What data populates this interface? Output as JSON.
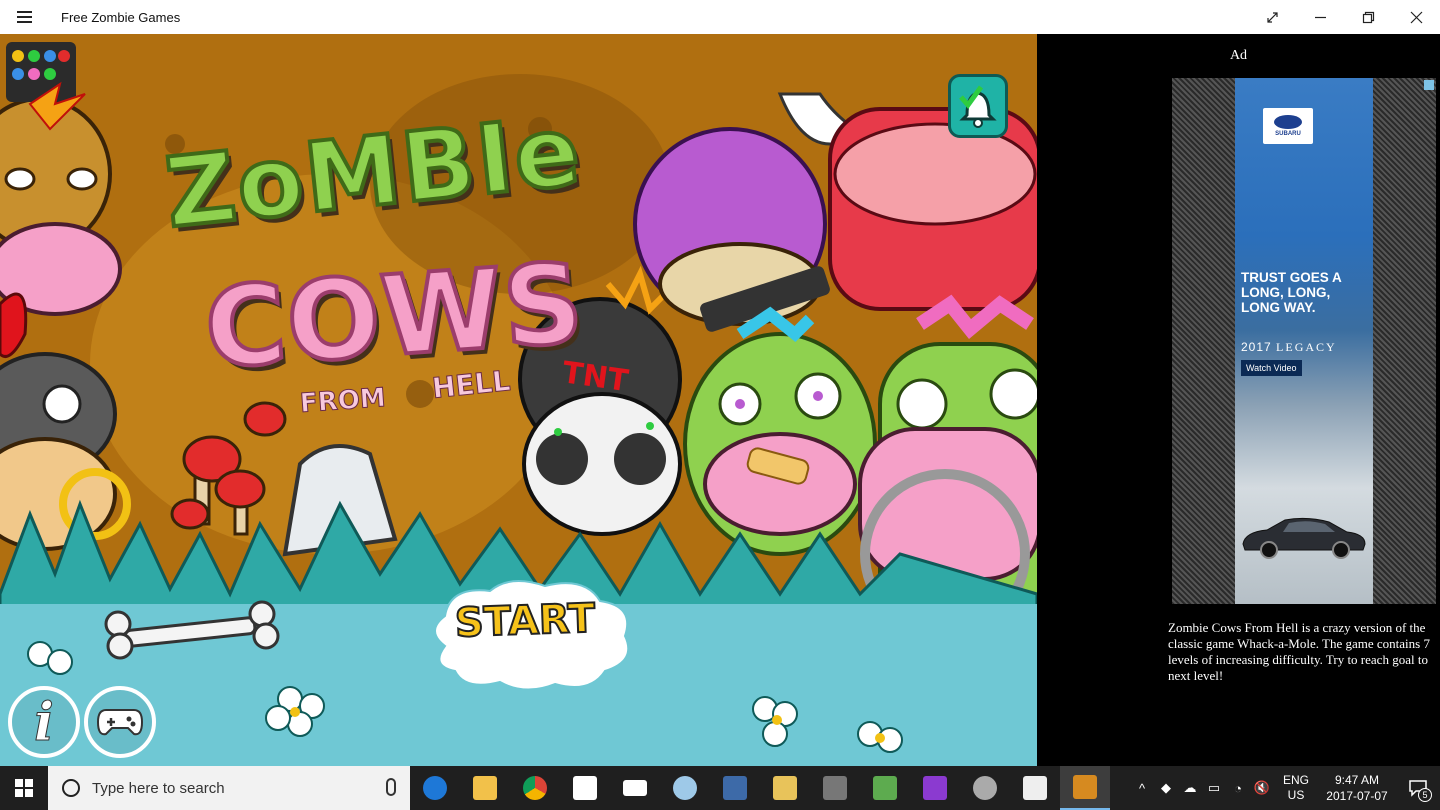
{
  "window": {
    "title": "Free Zombie Games",
    "menu_icon": "hamburger-icon",
    "controls": [
      "fullscreen-icon",
      "minimize-icon",
      "restore-icon",
      "close-icon"
    ]
  },
  "game": {
    "title_line1": "ZoMBIe",
    "title_line2": "COWS",
    "title_from": "FROM",
    "title_hell": "HELL",
    "tnt_label": "TNT",
    "start_label": "START",
    "info_label": "i",
    "icons": [
      "logo-icon",
      "bell-icon",
      "info-icon",
      "gamepad-icon"
    ]
  },
  "ad": {
    "label": "Ad",
    "brand": "SUBARU",
    "headline": "TRUST GOES A LONG, LONG, LONG WAY.",
    "model_year": "2017",
    "model_name": "LEGACY",
    "cta": "Watch Video",
    "description": "Zombie Cows From Hell is a crazy version of the classic game Whack-a-Mole. The game contains 7 levels of increasing difficulty. Try to reach goal to next level!"
  },
  "taskbar": {
    "search_placeholder": "Type here to search",
    "apps": [
      "edge-icon",
      "file-explorer-icon",
      "chrome-icon",
      "store-icon",
      "mail-icon",
      "paint-icon",
      "photos-icon",
      "notes-icon",
      "x-app-icon",
      "sheets-icon",
      "visual-studio-icon",
      "settings-icon",
      "box-icon",
      "zombie-games-icon"
    ],
    "language_line1": "ENG",
    "language_line2": "US",
    "time": "9:47 AM",
    "date": "2017-07-07",
    "notification_count": "5"
  },
  "colors": {
    "game_bg": "#b06f10",
    "grass": "#3fb3b0",
    "ground": "#6fc8d4",
    "zombie_green": "#8fd14f",
    "cow_pink": "#f5a0c8",
    "start_yellow": "#f6c21a",
    "accent_blue": "#76b9ed"
  }
}
